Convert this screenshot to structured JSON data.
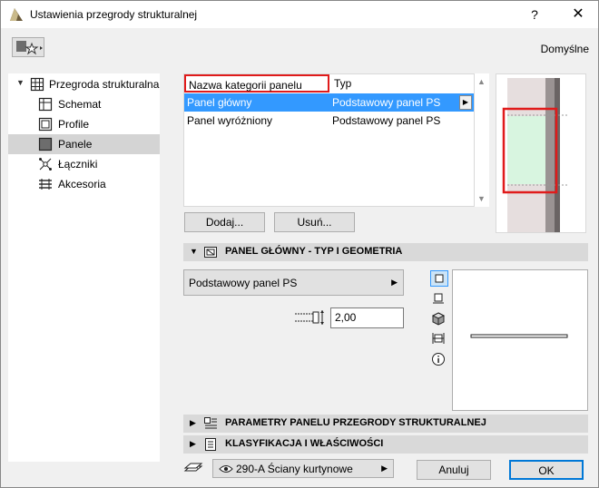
{
  "window": {
    "title": "Ustawienia przegrody strukturalnej",
    "help": "?",
    "close": "✕"
  },
  "header": {
    "defaults_label": "Domyślne"
  },
  "sidebar": {
    "items": [
      {
        "label": "Przegroda strukturalna",
        "icon": "curtain-wall-icon"
      },
      {
        "label": "Schemat",
        "icon": "scheme-icon"
      },
      {
        "label": "Profile",
        "icon": "profile-icon"
      },
      {
        "label": "Panele",
        "icon": "panel-icon"
      },
      {
        "label": "Łączniki",
        "icon": "connector-icon"
      },
      {
        "label": "Akcesoria",
        "icon": "accessory-icon"
      }
    ]
  },
  "panel_list": {
    "columns": {
      "name": "Nazwa kategorii panelu",
      "type": "Typ"
    },
    "rows": [
      {
        "name": "Panel główny",
        "type": "Podstawowy panel PS"
      },
      {
        "name": "Panel wyróżniony",
        "type": "Podstawowy panel PS"
      }
    ],
    "add_label": "Dodaj...",
    "remove_label": "Usuń..."
  },
  "section_main": {
    "title": "PANEL GŁÓWNY - TYP I GEOMETRIA",
    "type_value": "Podstawowy panel PS",
    "thickness_value": "2,00"
  },
  "section_params": {
    "title": "PARAMETRY PANELU PRZEGRODY STRUKTURALNEJ"
  },
  "section_class": {
    "title": "KLASYFIKACJA I WŁAŚCIWOŚCI"
  },
  "footer": {
    "layer_value": "290-A Ściany kurtynowe",
    "cancel_label": "Anuluj",
    "ok_label": "OK"
  },
  "colors": {
    "accent": "#0078d7",
    "highlight": "#e01b1b",
    "selection": "#3399ff"
  }
}
